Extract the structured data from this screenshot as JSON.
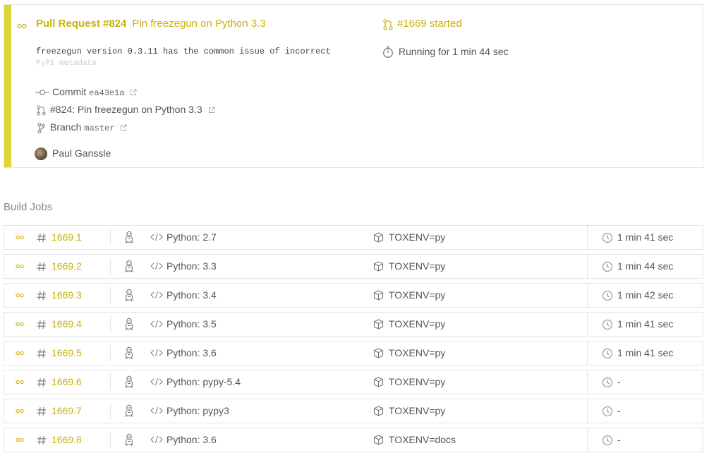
{
  "build": {
    "pr_label": "Pull Request #824",
    "pr_title": "Pin freezegun on Python 3.3",
    "build_status": "#1669 started",
    "duration": "Running for 1 min 44 sec",
    "commit_message_line1": "freezegun version 0.3.11 has the common issue of incorrect",
    "commit_message_line2": "PyPI metadata",
    "commit_label": "Commit",
    "commit_sha": "ea43e1a",
    "pr_link_text": "#824: Pin freezegun on Python 3.3",
    "branch_label": "Branch",
    "branch_name": "master",
    "author": "Paul Ganssle"
  },
  "section_title": "Build Jobs",
  "colors": {
    "accent": "#c9b20f",
    "stripe": "#e0d533"
  },
  "jobs": [
    {
      "number": "1669.1",
      "language": "Python: 2.7",
      "env": "TOXENV=py",
      "duration": "1 min 41 sec"
    },
    {
      "number": "1669.2",
      "language": "Python: 3.3",
      "env": "TOXENV=py",
      "duration": "1 min 44 sec"
    },
    {
      "number": "1669.3",
      "language": "Python: 3.4",
      "env": "TOXENV=py",
      "duration": "1 min 42 sec"
    },
    {
      "number": "1669.4",
      "language": "Python: 3.5",
      "env": "TOXENV=py",
      "duration": "1 min 41 sec"
    },
    {
      "number": "1669.5",
      "language": "Python: 3.6",
      "env": "TOXENV=py",
      "duration": "1 min 41 sec"
    },
    {
      "number": "1669.6",
      "language": "Python: pypy-5.4",
      "env": "TOXENV=py",
      "duration": "-"
    },
    {
      "number": "1669.7",
      "language": "Python: pypy3",
      "env": "TOXENV=py",
      "duration": "-"
    },
    {
      "number": "1669.8",
      "language": "Python: 3.6",
      "env": "TOXENV=docs",
      "duration": "-"
    }
  ]
}
